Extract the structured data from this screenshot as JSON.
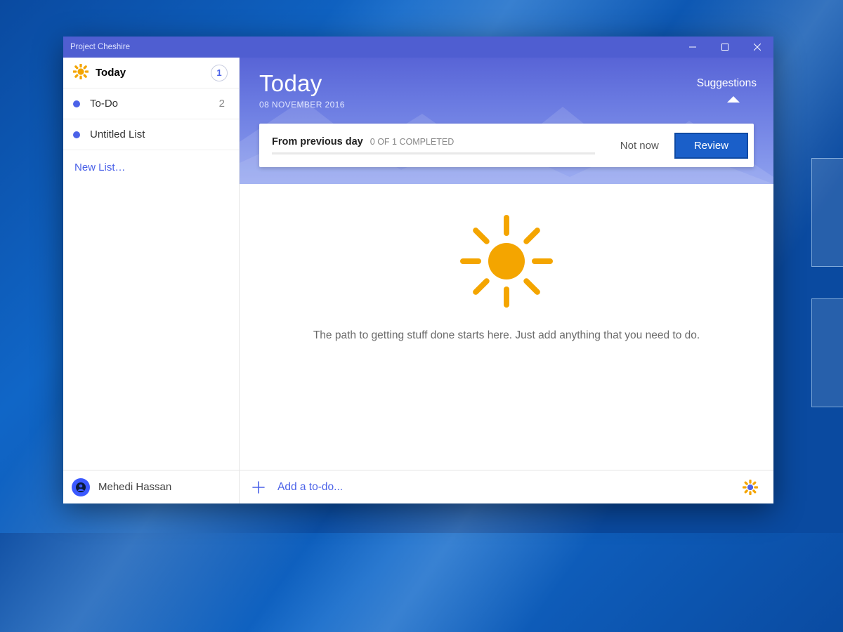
{
  "titlebar": {
    "title": "Project Cheshire"
  },
  "sidebar": {
    "items": [
      {
        "label": "Today",
        "count": "1"
      },
      {
        "label": "To-Do",
        "count": "2"
      },
      {
        "label": "Untitled List",
        "count": ""
      }
    ],
    "new_list_label": "New List…",
    "user": {
      "name": "Mehedi Hassan"
    }
  },
  "header": {
    "title": "Today",
    "date": "08 NOVEMBER 2016",
    "suggestions_label": "Suggestions"
  },
  "card": {
    "heading": "From previous day",
    "progress_text": "0 OF 1 COMPLETED",
    "not_now_label": "Not now",
    "review_label": "Review"
  },
  "empty_state": {
    "message": "The path to getting stuff done starts here. Just add anything that you need to do."
  },
  "add_bar": {
    "placeholder": "Add a to-do..."
  },
  "colors": {
    "accent": "#4b62e8",
    "sun": "#f4a500",
    "review_bg": "#1a5fc9"
  }
}
